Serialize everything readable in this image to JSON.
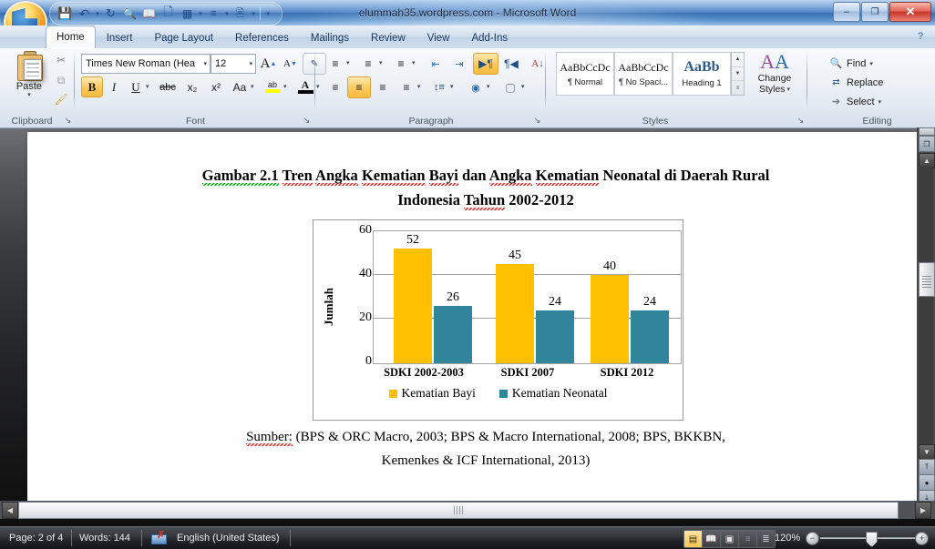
{
  "window": {
    "title": "elummah35.wordpress.com - Microsoft Word",
    "minimize": "–",
    "restore": "❐",
    "close": "✕"
  },
  "quick_access": {
    "items": [
      {
        "name": "save",
        "glyph": "💾"
      },
      {
        "name": "undo",
        "glyph": "↶",
        "caret": true
      },
      {
        "name": "redo",
        "glyph": "↻"
      },
      {
        "name": "print-preview",
        "glyph": "🔍"
      },
      {
        "name": "open",
        "glyph": "📖"
      },
      {
        "name": "new",
        "glyph": "🗋"
      },
      {
        "name": "table",
        "glyph": "▦",
        "caret": true
      },
      {
        "name": "paragraph-list",
        "glyph": "≡",
        "caret": true
      },
      {
        "name": "spelling",
        "glyph": "📄",
        "caret": true
      }
    ],
    "more_caret": "⌄"
  },
  "tabs": [
    {
      "label": "Home",
      "active": true
    },
    {
      "label": "Insert",
      "active": false
    },
    {
      "label": "Page Layout",
      "active": false
    },
    {
      "label": "References",
      "active": false
    },
    {
      "label": "Mailings",
      "active": false
    },
    {
      "label": "Review",
      "active": false
    },
    {
      "label": "View",
      "active": false
    },
    {
      "label": "Add-Ins",
      "active": false
    }
  ],
  "help_icon": "?",
  "ribbon": {
    "clipboard": {
      "name": "Clipboard",
      "paste_label": "Paste",
      "paste_caret": "▾",
      "cut": "✂",
      "copy": "⧉",
      "format_painter": "🖌",
      "dialog_launcher": "↘"
    },
    "font": {
      "name": "Font",
      "font_family": "Times New Roman (Hea",
      "font_size": "12",
      "grow_font": "A",
      "shrink_font": "A",
      "clear_formatting": "Aa",
      "bold": "B",
      "italic": "I",
      "underline": "U",
      "strikethrough": "abc",
      "subscript": "x₂",
      "superscript": "x²",
      "change_case": "Aa",
      "text_highlight": "ab",
      "font_color": "A",
      "caret": "▾",
      "dialog_launcher": "↘"
    },
    "paragraph": {
      "name": "Paragraph",
      "bullets": "☰",
      "numbering": "☰",
      "multilevel": "☰",
      "decrease_indent": "⬅",
      "increase_indent": "➡",
      "ltr_text": "¶",
      "rtl_text": "¶",
      "sort": "A↓",
      "show_marks": "¶",
      "align_left": "≡",
      "align_center": "≡",
      "align_right": "≡",
      "justify": "≡",
      "line_spacing": "↕",
      "shading": "■",
      "borders": "□",
      "caret": "▾",
      "dialog_launcher": "↘"
    },
    "styles": {
      "name": "Styles",
      "gallery": [
        {
          "sample": "AaBbCcDc",
          "label": "¶ Normal"
        },
        {
          "sample": "AaBbCcDc",
          "label": "¶ No Spaci..."
        },
        {
          "sample": "AaBb",
          "label": "Heading 1"
        }
      ],
      "scroll_up": "▲",
      "scroll_down": "▼",
      "more": "≡",
      "change_styles_label": "Change",
      "change_styles_label2": "Styles",
      "change_styles_caret": "▾",
      "change_styles_icon": "AA",
      "dialog_launcher": "↘"
    },
    "editing": {
      "name": "Editing",
      "items": [
        {
          "label": "Find",
          "icon": "🔍",
          "caret": "▾"
        },
        {
          "label": "Replace",
          "icon": "ab",
          "caret": ""
        },
        {
          "label": "Select",
          "icon": "↖",
          "caret": "▾"
        }
      ]
    }
  },
  "document": {
    "title_line1_pre": "Gambar 2.1",
    "title_line1_parts": [
      "Tren",
      "Angka",
      "Kematian",
      "Bayi",
      "dan",
      "Angka",
      "Kematian",
      "Neonatal",
      "di Daerah Rural"
    ],
    "title_line2_parts": [
      "Indonesia",
      "Tahun",
      "2002-2012"
    ],
    "title_full": "Gambar 2.1 Tren Angka Kematian Bayi dan Angka Kematian Neonatal di Daerah Rural Indonesia Tahun 2002-2012",
    "source_word": "Sumber:",
    "source_line1": "(BPS & ORC Macro, 2003; BPS & Macro International, 2008; BPS, BKKBN,",
    "source_line2": "Kemenkes & ICF International, 2013)"
  },
  "chart_data": {
    "type": "bar",
    "title": "",
    "categories": [
      "SDKI 2002-2003",
      "SDKI 2007",
      "SDKI 2012"
    ],
    "series": [
      {
        "name": "Kematian Bayi",
        "values": [
          52,
          45,
          40
        ],
        "color": "#FFC000"
      },
      {
        "name": "Kematian Neonatal",
        "values": [
          26,
          24,
          24
        ],
        "color": "#31859B"
      }
    ],
    "xlabel": "",
    "ylabel": "Jumlah",
    "ylim": [
      0,
      60
    ],
    "yticks": [
      0,
      20,
      40,
      60
    ],
    "grid": true,
    "legend_position": "bottom",
    "data_labels": true
  },
  "scrollbars": {
    "v_up": "▲",
    "v_down": "▼",
    "h_left": "◀",
    "h_right": "▶",
    "select_browse_object": "●",
    "previous_page": "⤒",
    "next_page": "⤓",
    "split_handle": "",
    "page_icon": "❐"
  },
  "status_bar": {
    "page": "Page: 2 of 4",
    "words": "Words: 144",
    "proofing_icon": "spelling-errors-icon",
    "language": "English (United States)",
    "view_buttons": [
      {
        "name": "print-layout",
        "glyph": "▤",
        "active": true
      },
      {
        "name": "full-screen-reading",
        "glyph": "📖",
        "active": false
      },
      {
        "name": "web-layout",
        "glyph": "▥",
        "active": false
      },
      {
        "name": "outline",
        "glyph": "☰",
        "active": false
      },
      {
        "name": "draft",
        "glyph": "≡",
        "active": false
      }
    ],
    "zoom_level": "120%",
    "zoom_out": "−",
    "zoom_in": "+"
  }
}
